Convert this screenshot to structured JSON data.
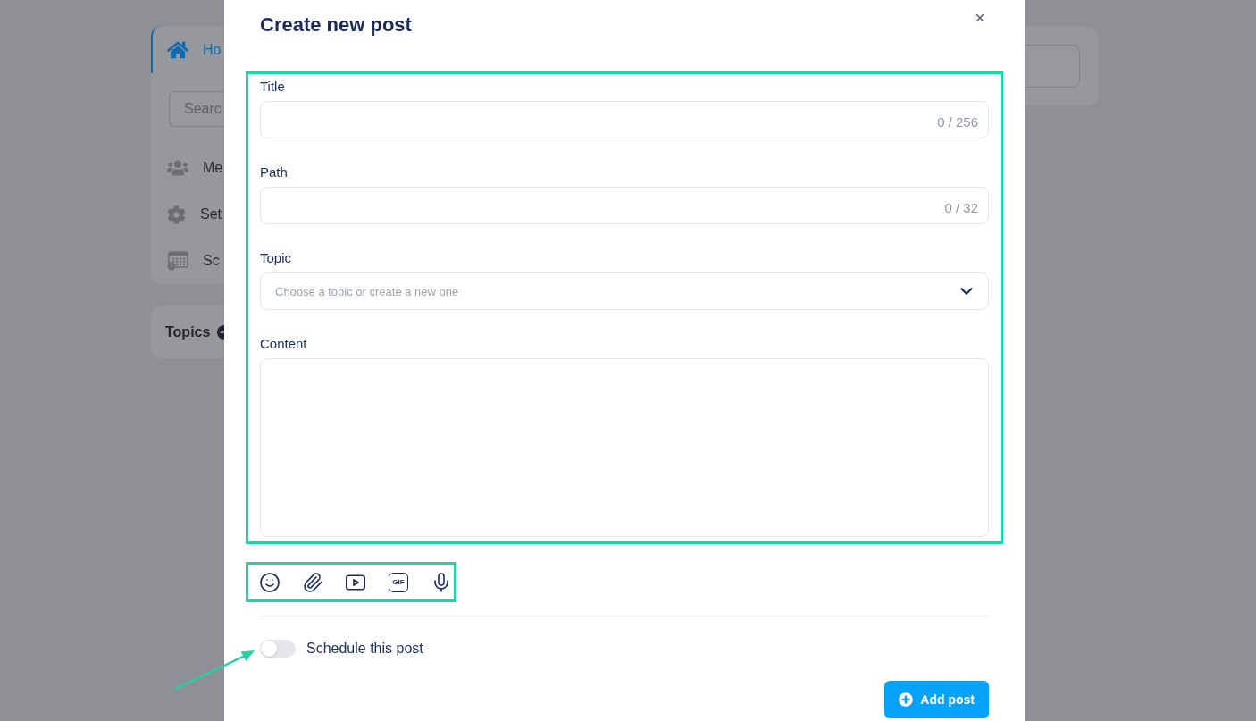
{
  "sidebar": {
    "home_link": {
      "label": "Ho",
      "selected": true
    },
    "search": {
      "placeholder": "Searc"
    },
    "items": [
      {
        "kind": "members",
        "label": "Me",
        "selected": false
      },
      {
        "kind": "settings",
        "label": "Set",
        "selected": false
      },
      {
        "kind": "schedule",
        "label": "Sc",
        "selected": false
      }
    ]
  },
  "topics_panel": {
    "title": "Topics"
  },
  "modal": {
    "title": "Create new post",
    "fields": [
      {
        "kind": "text",
        "label": "Title",
        "counter": "0 / 256"
      },
      {
        "kind": "text",
        "label": "Path",
        "counter": "0 / 32"
      },
      {
        "kind": "select",
        "label": "Topic",
        "placeholder": "Choose a topic or create a new one"
      },
      {
        "kind": "textarea",
        "label": "Content"
      }
    ],
    "toolbar": [
      {
        "kind": "emoji"
      },
      {
        "kind": "attachment"
      },
      {
        "kind": "video"
      },
      {
        "kind": "gif",
        "label": "GIF"
      },
      {
        "kind": "microphone"
      }
    ],
    "schedule": {
      "label": "Schedule this post",
      "on": false
    },
    "submit": {
      "label": "Add post"
    }
  }
}
